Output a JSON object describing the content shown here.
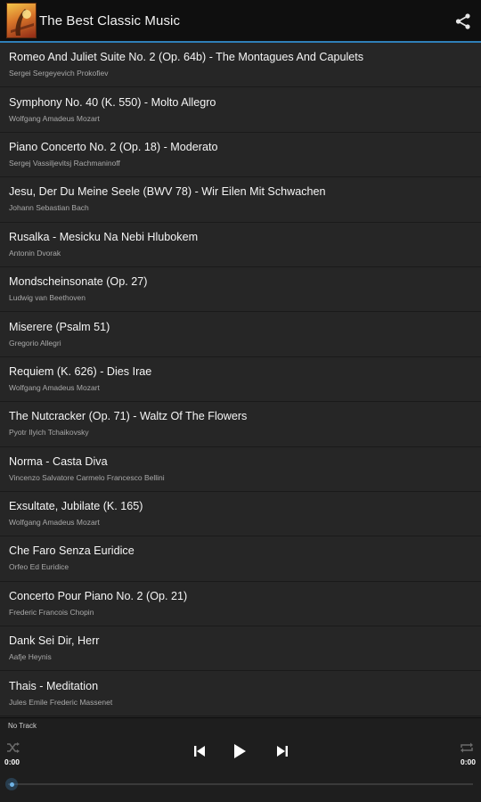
{
  "app": {
    "title": "The Best Classic Music"
  },
  "tracks": [
    {
      "title": "Romeo And Juliet Suite No. 2 (Op. 64b) - The Montagues And Capulets",
      "artist": "Sergei Sergeyevich Prokofiev"
    },
    {
      "title": "Symphony No. 40 (K. 550) - Molto Allegro",
      "artist": "Wolfgang Amadeus Mozart"
    },
    {
      "title": "Piano Concerto No. 2 (Op. 18) - Moderato",
      "artist": "Sergej Vassiljevitsj Rachmaninoff"
    },
    {
      "title": "Jesu, Der Du Meine Seele (BWV 78) - Wir Eilen Mit Schwachen",
      "artist": "Johann Sebastian Bach"
    },
    {
      "title": "Rusalka - Mesicku Na Nebi Hlubokem",
      "artist": "Antonin Dvorak"
    },
    {
      "title": "Mondscheinsonate (Op. 27)",
      "artist": "Ludwig van Beethoven"
    },
    {
      "title": "Miserere (Psalm 51)",
      "artist": "Gregorio Allegri"
    },
    {
      "title": "Requiem (K. 626) - Dies Irae",
      "artist": "Wolfgang Amadeus Mozart"
    },
    {
      "title": "The Nutcracker (Op. 71) - Waltz Of The Flowers",
      "artist": "Pyotr Ilyich Tchaikovsky"
    },
    {
      "title": "Norma - Casta Diva",
      "artist": "Vincenzo Salvatore Carmelo Francesco Bellini"
    },
    {
      "title": "Exsultate, Jubilate (K. 165)",
      "artist": "Wolfgang Amadeus Mozart"
    },
    {
      "title": "Che Faro Senza Euridice",
      "artist": "Orfeo Ed Euridice"
    },
    {
      "title": "Concerto Pour Piano No. 2 (Op. 21)",
      "artist": "Frederic Francois Chopin"
    },
    {
      "title": "Dank Sei Dir, Herr",
      "artist": "Aafje Heynis"
    },
    {
      "title": "Thais - Meditation",
      "artist": "Jules Emile Frederic Massenet"
    }
  ],
  "player": {
    "now_playing": "No Track",
    "elapsed": "0:00",
    "duration": "0:00",
    "progress": 0
  },
  "icons": {
    "share": "share-icon",
    "shuffle": "shuffle-icon",
    "repeat": "repeat-icon",
    "previous": "skip-previous-icon",
    "play": "play-icon",
    "next": "skip-next-icon"
  },
  "colors": {
    "accent": "#2f7fb8",
    "seek_thumb": "#6fb3e6"
  }
}
